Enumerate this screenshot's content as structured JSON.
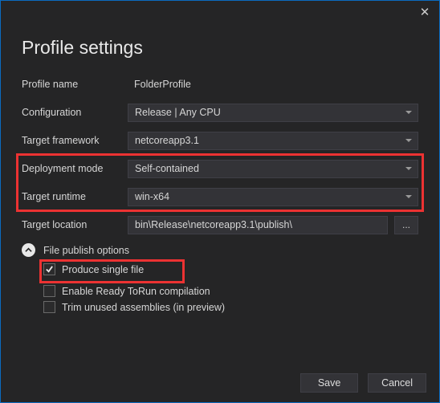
{
  "title": "Profile settings",
  "fields": {
    "profile_name": {
      "label": "Profile name",
      "value": "FolderProfile"
    },
    "configuration": {
      "label": "Configuration",
      "value": "Release | Any CPU"
    },
    "target_framework": {
      "label": "Target framework",
      "value": "netcoreapp3.1"
    },
    "deployment_mode": {
      "label": "Deployment mode",
      "value": "Self-contained"
    },
    "target_runtime": {
      "label": "Target runtime",
      "value": "win-x64"
    },
    "target_location": {
      "label": "Target location",
      "value": "bin\\Release\\netcoreapp3.1\\publish\\"
    }
  },
  "browse_label": "...",
  "expander": {
    "label": "File publish options"
  },
  "options": {
    "produce_single_file": {
      "label": "Produce single file",
      "checked": true
    },
    "ready_to_run": {
      "label": "Enable Ready ToRun compilation",
      "checked": false
    },
    "trim_assemblies": {
      "label": "Trim unused assemblies (in preview)",
      "checked": false
    }
  },
  "buttons": {
    "save": "Save",
    "cancel": "Cancel"
  }
}
